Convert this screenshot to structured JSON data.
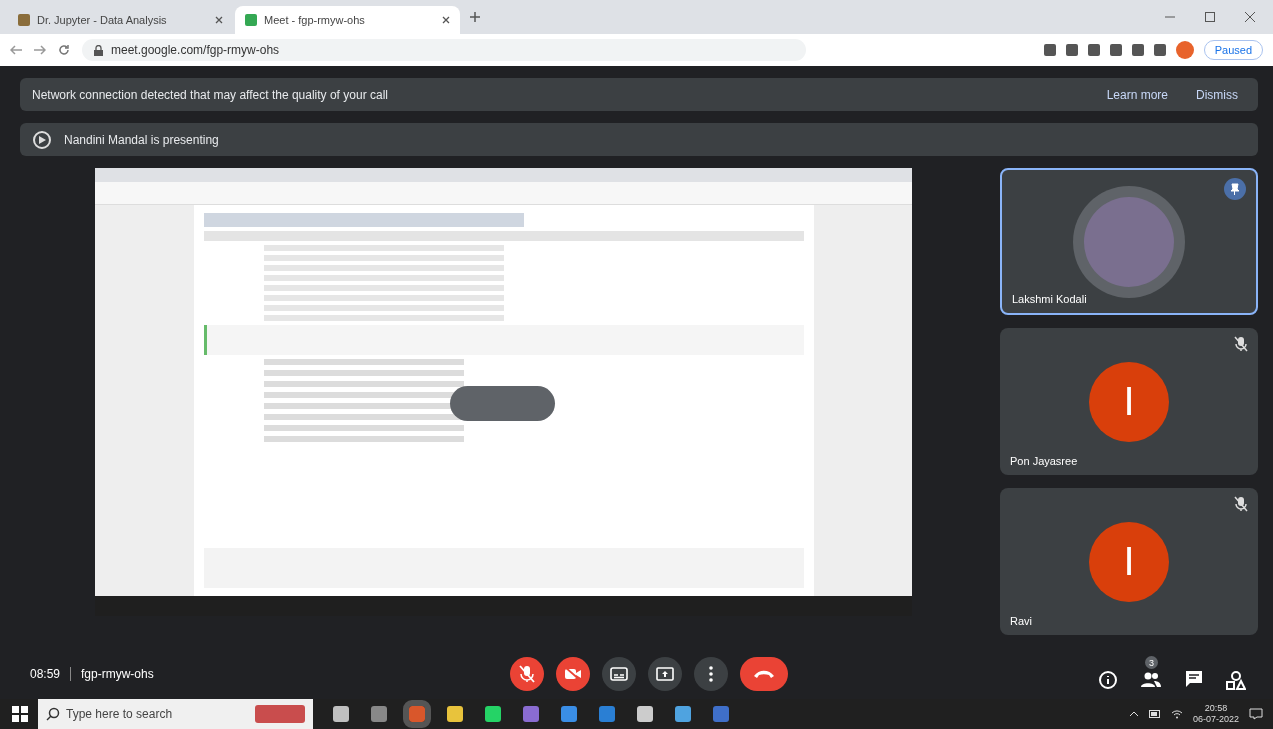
{
  "browser": {
    "tabs": [
      {
        "title": "Dr. Jupyter - Data Analysis",
        "selected": false
      },
      {
        "title": "Meet - fgp-rmyw-ohs",
        "selected": true
      }
    ],
    "address": "meet.google.com/fgp-rmyw-ohs",
    "profile_button": "Paused"
  },
  "notices": [
    {
      "kind": "warning",
      "text": "Network connection detected that may affect the quality of your call",
      "actions": [
        "Learn more",
        "Dismiss"
      ]
    },
    {
      "kind": "presenting",
      "text": "Nandini Mandal is presenting"
    }
  ],
  "participants": [
    {
      "name": "Lakshmi Kodali",
      "kind": "photo",
      "pinned": true,
      "muted": false
    },
    {
      "name": "Pon Jayasree",
      "kind": "letter",
      "initial": "I",
      "pinned": false,
      "muted": true
    },
    {
      "name": "Ravi",
      "kind": "letter",
      "initial": "I",
      "pinned": false,
      "muted": true
    }
  ],
  "meeting": {
    "time": "08:59",
    "code": "fgp-rmyw-ohs"
  },
  "controls": [
    {
      "kind": "mic",
      "on": false
    },
    {
      "kind": "camera",
      "on": false
    },
    {
      "kind": "captions"
    },
    {
      "kind": "present"
    },
    {
      "kind": "more"
    },
    {
      "kind": "end"
    }
  ],
  "side_buttons": [
    {
      "kind": "info"
    },
    {
      "kind": "people",
      "badge": "3"
    },
    {
      "kind": "chat"
    },
    {
      "kind": "activities"
    }
  ],
  "taskbar": {
    "search_placeholder": "Type here to search",
    "time": "20:58",
    "date": "06-07-2022"
  }
}
